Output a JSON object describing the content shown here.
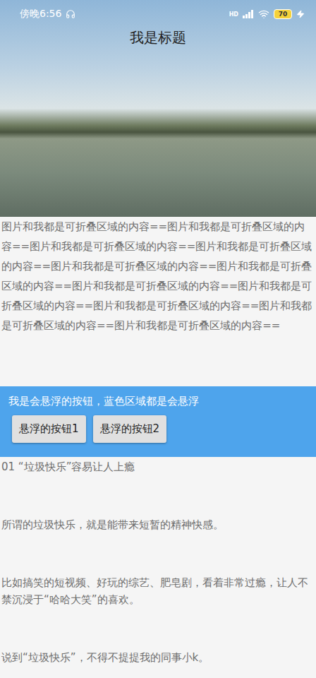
{
  "status_bar": {
    "time": "傍晚6:56",
    "network": "HD",
    "battery": "70",
    "charging": true
  },
  "header": {
    "title": "我是标题"
  },
  "collapsible_text": "图片和我都是可折叠区域的内容==图片和我都是可折叠区域的内容==图片和我都是可折叠区域的内容==图片和我都是可折叠区域的内容==图片和我都是可折叠区域的内容==图片和我都是可折叠区域的内容==图片和我都是可折叠区域的内容==图片和我都是可折叠区域的内容==图片和我都是可折叠区域的内容==图片和我都是可折叠区域的内容==图片和我都是可折叠区域的内容==",
  "floating_bar": {
    "label": "我是会悬浮的按钮，蓝色区域都是会悬浮",
    "buttons": [
      "悬浮的按钮1",
      "悬浮的按钮2"
    ]
  },
  "article": {
    "paragraphs": [
      "01 “垃圾快乐”容易让人上瘾",
      "所谓的垃圾快乐，就是能带来短暂的精神快感。",
      "比如搞笑的短视频、好玩的综艺、肥皂剧，看着非常过瘾，让人不禁沉浸于“哈哈大笑”的喜欢。",
      "说到“垃圾快乐”，不得不提提我的同事小k。"
    ]
  }
}
